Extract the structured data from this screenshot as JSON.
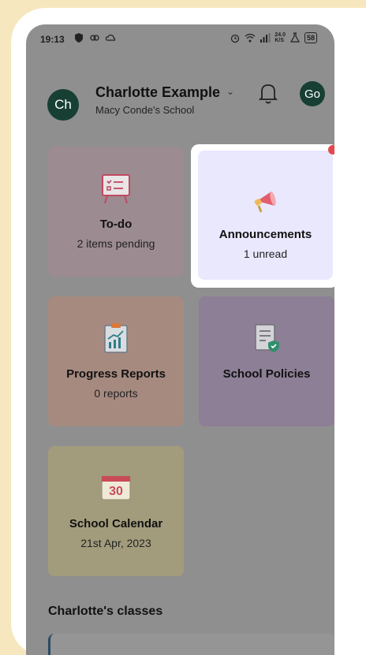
{
  "status_bar": {
    "time": "19:13",
    "left_icons": [
      "shield-icon",
      "link-icon",
      "cloud-icon"
    ],
    "right_icons": [
      "alarm-icon",
      "wifi-icon",
      "signal-icon",
      "speed-indicator-icon",
      "flask-icon"
    ],
    "network_speed": "24.0",
    "network_unit": "K/S",
    "battery": "58"
  },
  "header": {
    "avatar_initials": "Ch",
    "user_name": "Charlotte Example",
    "school_name": "Macy Conde's School",
    "secondary_avatar": "Go"
  },
  "tiles": {
    "todo": {
      "title": "To-do",
      "subtitle": "2 items pending",
      "icon": "checklist-board-icon"
    },
    "announcements": {
      "title": "Announcements",
      "subtitle": "1 unread",
      "icon": "megaphone-icon"
    },
    "progress_reports": {
      "title": "Progress Reports",
      "subtitle": "0 reports",
      "icon": "clipboard-chart-icon"
    },
    "school_policies": {
      "title": "School Policies",
      "icon": "document-shield-icon"
    },
    "school_calendar": {
      "title": "School Calendar",
      "subtitle": "21st Apr, 2023",
      "icon": "calendar-icon",
      "calendar_day": "30"
    }
  },
  "classes_section": {
    "heading": "Charlotte's classes"
  },
  "colors": {
    "overlay": "#8F8F8F",
    "avatar": "#173F33",
    "highlight": "#EAE8FD",
    "unread_dot": "#E4484C",
    "background": "#F7E7BF"
  }
}
